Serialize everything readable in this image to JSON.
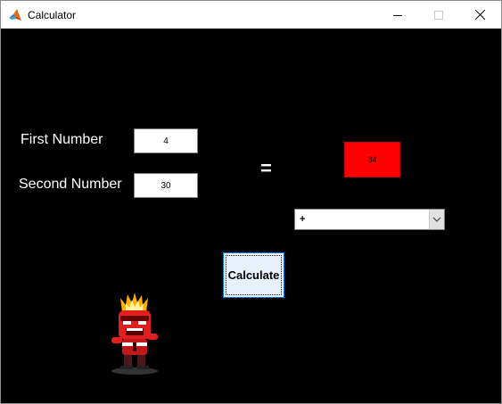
{
  "window": {
    "title": "Calculator"
  },
  "form": {
    "first_label": "First Number",
    "first_value": "4",
    "second_label": "Second Number",
    "second_value": "30",
    "equals": "=",
    "result": "34",
    "operator_selected": "+",
    "calculate_label": "Calculate"
  },
  "colors": {
    "background": "#000000",
    "result_bg": "#ff0000",
    "button_focus": "#0078d7"
  },
  "icons": {
    "app": "matlab-logo-icon",
    "minimize": "minimize-icon",
    "maximize": "maximize-icon",
    "close": "close-icon",
    "dropdown": "chevron-down-icon",
    "mascot": "anger-character-image"
  }
}
